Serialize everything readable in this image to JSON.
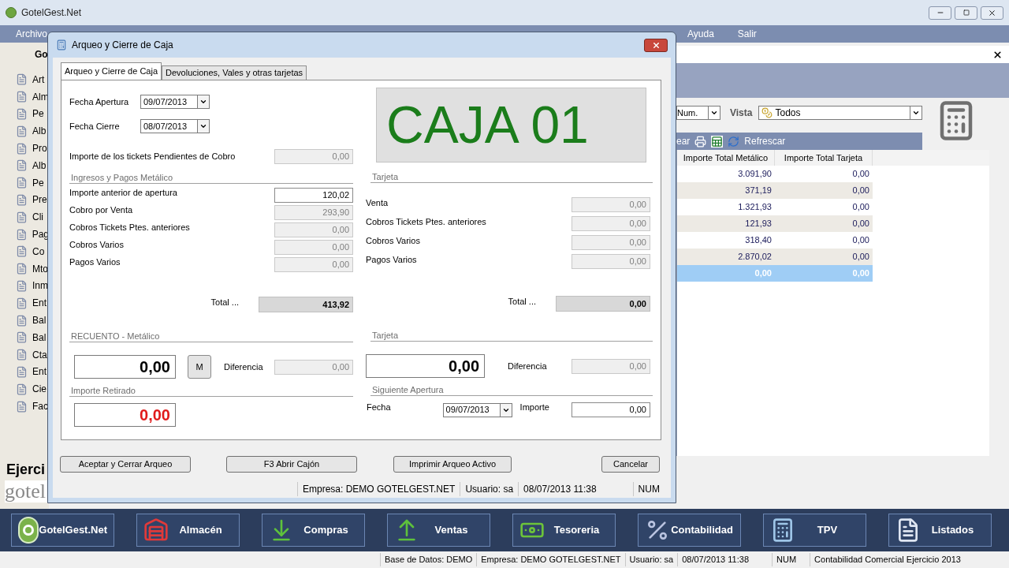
{
  "app": {
    "title": "GotelGest.Net"
  },
  "menu": [
    {
      "label": "Archivo"
    },
    {
      "label": "Ayuda"
    },
    {
      "label": "Salir"
    }
  ],
  "sidebar": {
    "heading": "Go",
    "items": [
      "Art",
      "Alm",
      "Pe",
      "Alb",
      "Pro",
      "Alb",
      "Pe",
      "Pre",
      "Cli",
      "Pag",
      "Co",
      "Mto",
      "Inm",
      "Ent",
      "Bal",
      "Bal",
      "Cta",
      "Ent",
      "Cie",
      "Fac"
    ],
    "footer_title": "Ejerci",
    "logo_text": "gotel"
  },
  "panel": {
    "filter_value": "Num.",
    "view_label": "Vista",
    "view_value": "Todos",
    "toolbar_text": "ear",
    "refresh_label": "Refrescar",
    "table": {
      "columns": [
        "Importe Total Metálico",
        "Importe Total Tarjeta"
      ],
      "rows": [
        {
          "cells": [
            "3.091,90",
            "0,00"
          ],
          "selected": false
        },
        {
          "cells": [
            "371,19",
            "0,00"
          ],
          "selected": false
        },
        {
          "cells": [
            "1.321,93",
            "0,00"
          ],
          "selected": false
        },
        {
          "cells": [
            "121,93",
            "0,00"
          ],
          "selected": false
        },
        {
          "cells": [
            "318,40",
            "0,00"
          ],
          "selected": false
        },
        {
          "cells": [
            "2.870,02",
            "0,00"
          ],
          "selected": false
        },
        {
          "cells": [
            "0,00",
            "0,00"
          ],
          "selected": true
        }
      ]
    }
  },
  "dialog": {
    "title": "Arqueo y Cierre de Caja",
    "tabs": [
      {
        "label": "Arqueo y Cierre de Caja",
        "selected": true
      },
      {
        "label": "Devoluciones, Vales y otras tarjetas",
        "selected": false
      }
    ],
    "fecha_apertura": {
      "label": "Fecha Apertura",
      "value": "09/07/2013"
    },
    "fecha_cierre": {
      "label": "Fecha Cierre",
      "value": "08/07/2013"
    },
    "caja": "CAJA 01",
    "pendientes": {
      "label": "Importe de los tickets Pendientes de Cobro",
      "value": "0,00",
      "disabled": true
    },
    "metalico": {
      "title": "Ingresos y Pagos Metálico",
      "rows": [
        {
          "label": "Importe anterior de apertura",
          "value": "120,02",
          "disabled": false
        },
        {
          "label": "Cobro por Venta",
          "value": "293,90",
          "disabled": true
        },
        {
          "label": "Cobros Tickets Ptes. anteriores",
          "value": "0,00",
          "disabled": true
        },
        {
          "label": "Cobros Varios",
          "value": "0,00",
          "disabled": true
        },
        {
          "label": "Pagos Varios",
          "value": "0,00",
          "disabled": true
        }
      ],
      "total_label": "Total ...",
      "total": "413,92"
    },
    "tarjeta": {
      "title": "Tarjeta",
      "rows": [
        {
          "label": "Venta",
          "value": "0,00",
          "disabled": true
        },
        {
          "label": "Cobros Tickets Ptes. anteriores",
          "value": "0,00",
          "disabled": true
        },
        {
          "label": "Cobros Varios",
          "value": "0,00",
          "disabled": true
        },
        {
          "label": "Pagos Varios",
          "value": "0,00",
          "disabled": true
        }
      ],
      "total_label": "Total ...",
      "total": "0,00"
    },
    "recuento": {
      "title": "RECUENTO - Metálico",
      "value": "0,00",
      "m_button": "M",
      "diff_label": "Diferencia",
      "diff": "0,00"
    },
    "recuento_tarjeta": {
      "title": "Tarjeta",
      "value": "0,00",
      "diff_label": "Diferencia",
      "diff": "0,00"
    },
    "retirado": {
      "title": "Importe Retirado",
      "value": "0,00"
    },
    "siguiente": {
      "title": "Siguiente Apertura",
      "fecha_label": "Fecha",
      "fecha": "09/07/2013",
      "importe_label": "Importe",
      "importe": "0,00"
    },
    "buttons": [
      "Aceptar y Cerrar Arqueo",
      "F3 Abrir Cajón",
      "Imprimir Arqueo Activo",
      "Cancelar"
    ],
    "status_bar": [
      "Empresa: DEMO GOTELGEST.NET",
      "Usuario: sa",
      "08/07/2013 11:38",
      "NUM"
    ]
  },
  "taskbar": [
    {
      "label": "GotelGest.Net",
      "kind": "logo"
    },
    {
      "label": "Almacén",
      "kind": "warehouse"
    },
    {
      "label": "Compras",
      "kind": "download"
    },
    {
      "label": "Ventas",
      "kind": "upload"
    },
    {
      "label": "Tesoreria",
      "kind": "money"
    },
    {
      "label": "Contabilidad",
      "kind": "percent"
    },
    {
      "label": "TPV",
      "kind": "register"
    },
    {
      "label": "Listados",
      "kind": "document"
    }
  ],
  "status_bar": [
    "Base de Datos: DEMO",
    "Empresa: DEMO GOTELGEST.NET",
    "Usuario: sa",
    "08/07/2013 11:38",
    "NUM",
    "Contabilidad Comercial Ejercicio 2013"
  ]
}
